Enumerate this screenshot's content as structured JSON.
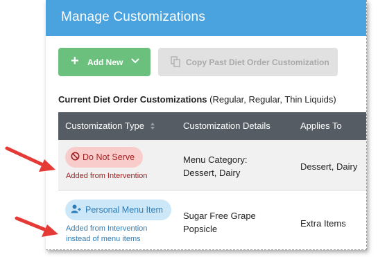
{
  "header": {
    "title": "Manage Customizations"
  },
  "toolbar": {
    "add_new_label": "Add New",
    "copy_label": "Copy Past Diet Order Customization"
  },
  "section": {
    "title_bold": "Current Diet Order Customizations",
    "title_extra": "(Regular, Regular, Thin Liquids)"
  },
  "table": {
    "columns": [
      "Customization Type",
      "Customization Details",
      "Applies To"
    ],
    "rows": [
      {
        "type": "Do Not Serve",
        "type_icon": "prohibited-icon",
        "note": "Added from Intervention",
        "details_line1": "Menu Category:",
        "details_line2": "Dessert, Dairy",
        "applies_to": "Dessert, Dairy"
      },
      {
        "type": "Personal Menu Item",
        "type_icon": "person-icon",
        "note_line1": "Added from Intervention",
        "note_line2": "instead of menu items",
        "details_line1": "Sugar Free Grape",
        "details_line2": "Popsicle",
        "applies_to": "Extra Items"
      }
    ]
  },
  "colors": {
    "header_bg": "#4aa3df",
    "add_button_bg": "#6cc07e",
    "table_header_bg": "#555c63",
    "red_badge_bg": "#f9cccc",
    "blue_badge_bg": "#cce8f8",
    "arrow": "#e53935"
  }
}
